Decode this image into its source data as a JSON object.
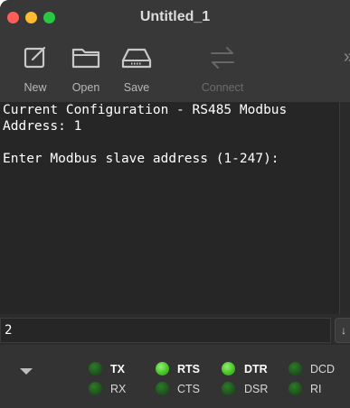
{
  "window": {
    "title": "Untitled_1"
  },
  "toolbar": {
    "new_label": "New",
    "open_label": "Open",
    "save_label": "Save",
    "connect_label": "Connect",
    "overflow_label": "»"
  },
  "terminal": {
    "lines": [
      "Current Configuration - RS485 Modbus",
      "Address: 1",
      "",
      "Enter Modbus slave address (1-247):"
    ]
  },
  "input": {
    "value": "2",
    "send_label": "↓"
  },
  "signals": {
    "tx": {
      "label": "TX",
      "on": false
    },
    "rx": {
      "label": "RX",
      "on": false
    },
    "rts": {
      "label": "RTS",
      "on": true
    },
    "cts": {
      "label": "CTS",
      "on": false
    },
    "dtr": {
      "label": "DTR",
      "on": true
    },
    "dsr": {
      "label": "DSR",
      "on": false
    },
    "dcd": {
      "label": "DCD",
      "on": false
    },
    "ri": {
      "label": "RI",
      "on": false
    }
  },
  "colors": {
    "led_on": "#4cd22a",
    "led_off": "#235f20",
    "terminal_bg": "#262626"
  }
}
